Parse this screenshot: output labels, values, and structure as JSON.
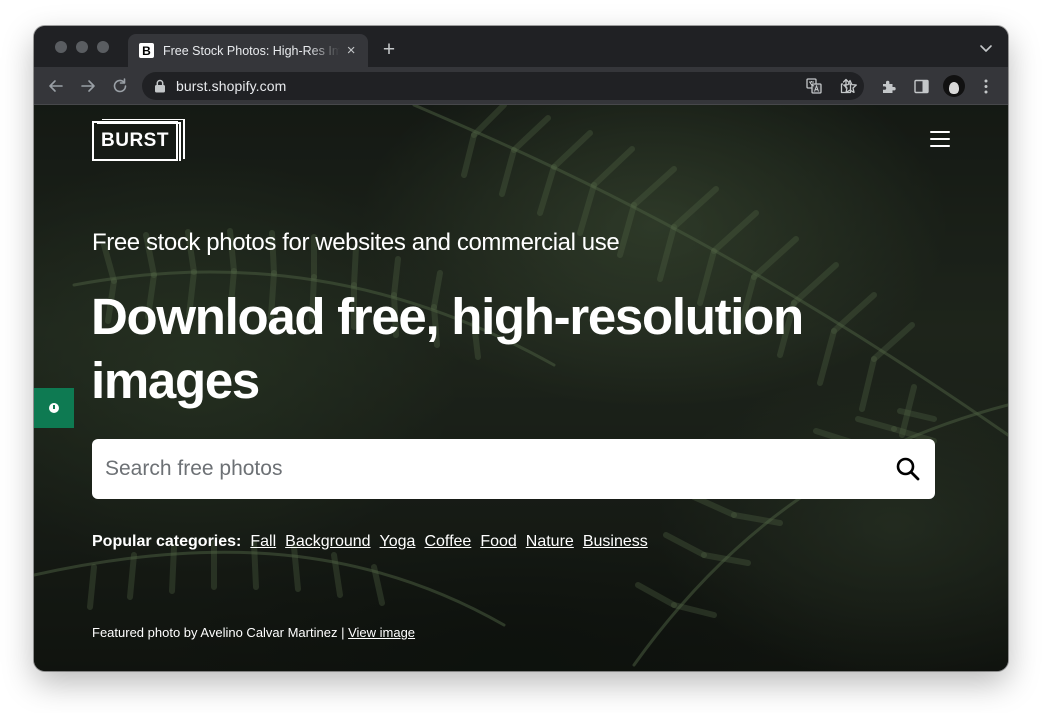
{
  "browser": {
    "tab": {
      "favicon_letter": "B",
      "title": "Free Stock Photos: High-Res Images",
      "close_glyph": "×"
    },
    "new_tab_glyph": "+",
    "address": "burst.shopify.com",
    "icons": [
      "back-icon",
      "forward-icon",
      "reload-icon",
      "lock-icon",
      "translate-icon",
      "share-icon",
      "star-icon",
      "extensions-icon",
      "side-panel-icon",
      "avatar",
      "more-icon",
      "tab-search-icon"
    ]
  },
  "page": {
    "logo_text": "BURST",
    "tagline": "Free stock photos for websites and commercial use",
    "headline": "Download free, high-resolution images",
    "search": {
      "placeholder": "Search free photos"
    },
    "categories": {
      "label": "Popular categories:",
      "items": [
        "Fall",
        "Background",
        "Yoga",
        "Coffee",
        "Food",
        "Nature",
        "Business"
      ]
    },
    "credit": {
      "text": "Featured photo by Avelino Calvar Martinez |",
      "link": "View image"
    },
    "colors": {
      "feedback_tab": "#0e7a52",
      "page_overlay": "#1b211a",
      "browser_chrome": "#35363a"
    }
  }
}
